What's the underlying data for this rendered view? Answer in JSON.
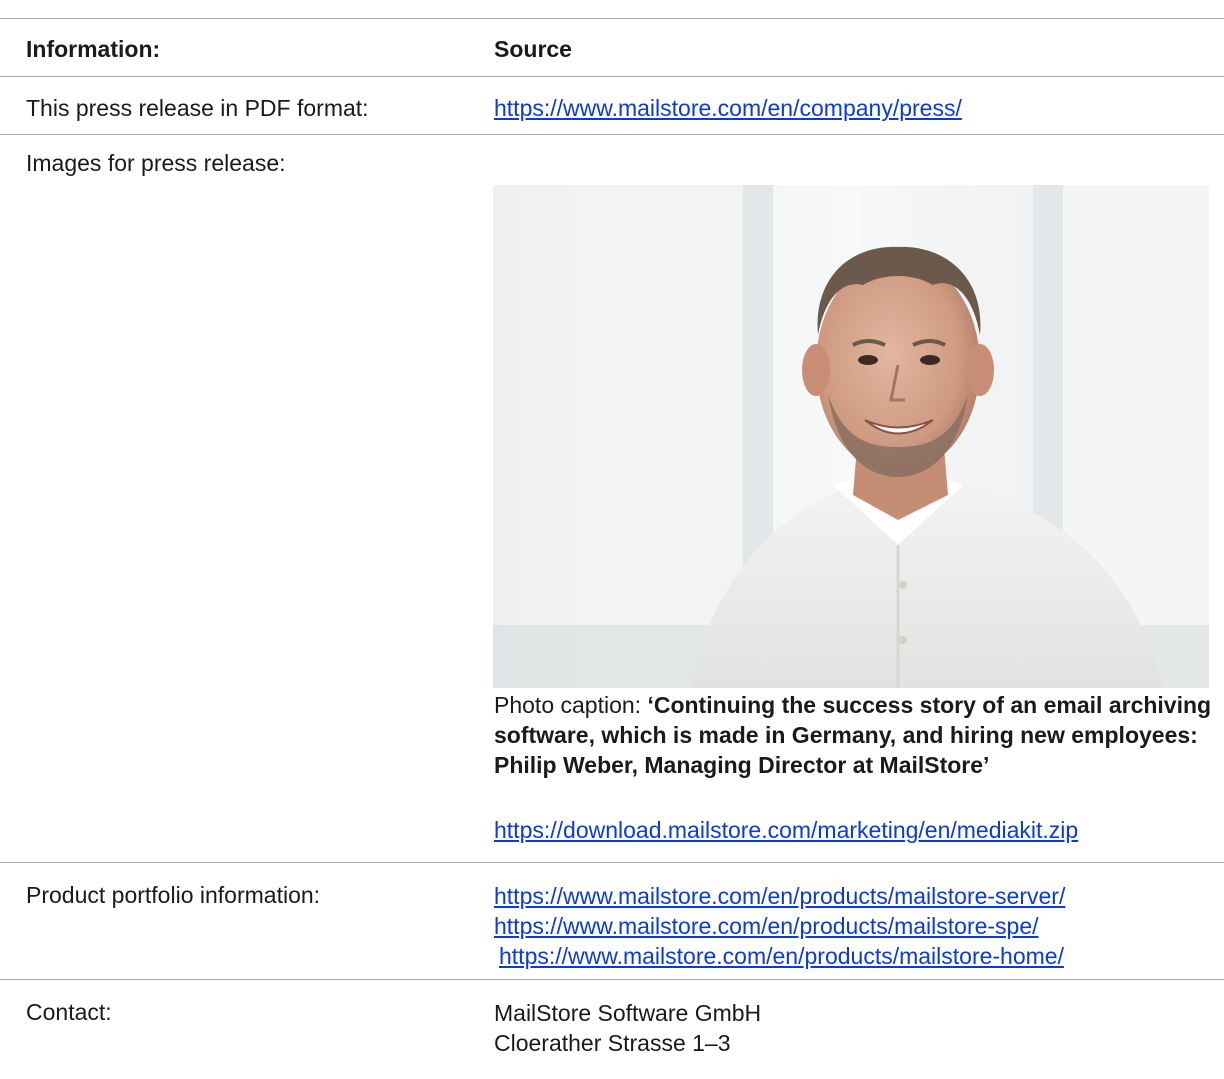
{
  "table": {
    "header": {
      "left": "Information:",
      "right": "Source"
    },
    "pdf_row": {
      "label": "This press release in PDF format:",
      "link": "https://www.mailstore.com/en/company/press/"
    },
    "images_row": {
      "label": "Images for press release:",
      "caption_prefix": "Photo caption: ",
      "caption_bold": "‘Continuing the success story of an email archiving software, which is made in Germany, and hiring new employees: Philip Weber, Managing Director at MailStore’",
      "link": "https://download.mailstore.com/marketing/en/mediakit.zip"
    },
    "portfolio_row": {
      "label": "Product portfolio information:",
      "links": [
        "https://www.mailstore.com/en/products/mailstore-server/",
        "https://www.mailstore.com/en/products/mailstore-spe/",
        "https://www.mailstore.com/en/products/mailstore-home/"
      ]
    },
    "contact_row": {
      "label": "Contact:",
      "lines": [
        "MailStore Software GmbH",
        "Cloerather Strasse 1–3"
      ]
    }
  },
  "colors": {
    "link": "#0b3bd6",
    "rule": "#a8a8a8",
    "text": "#1a1a1a"
  }
}
